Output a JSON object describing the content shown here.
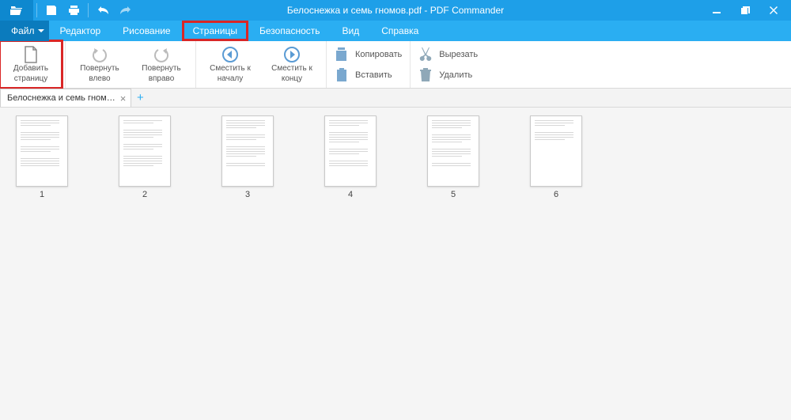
{
  "titlebar": {
    "title": "Белоснежка и семь гномов.pdf - PDF Commander"
  },
  "menu": {
    "file": "Файл",
    "editor": "Редактор",
    "drawing": "Рисование",
    "pages": "Страницы",
    "security": "Безопасность",
    "view": "Вид",
    "help": "Справка"
  },
  "ribbon": {
    "add_page_l1": "Добавить",
    "add_page_l2": "страницу",
    "rotate_left_l1": "Повернуть",
    "rotate_left_l2": "влево",
    "rotate_right_l1": "Повернуть",
    "rotate_right_l2": "вправо",
    "shift_start_l1": "Сместить к",
    "shift_start_l2": "началу",
    "shift_end_l1": "Сместить к",
    "shift_end_l2": "концу",
    "copy": "Копировать",
    "paste": "Вставить",
    "cut": "Вырезать",
    "delete": "Удалить"
  },
  "doctab": {
    "name": "Белоснежка и семь гном…"
  },
  "pages": [
    {
      "n": "1"
    },
    {
      "n": "2"
    },
    {
      "n": "3"
    },
    {
      "n": "4"
    },
    {
      "n": "5"
    },
    {
      "n": "6"
    }
  ]
}
